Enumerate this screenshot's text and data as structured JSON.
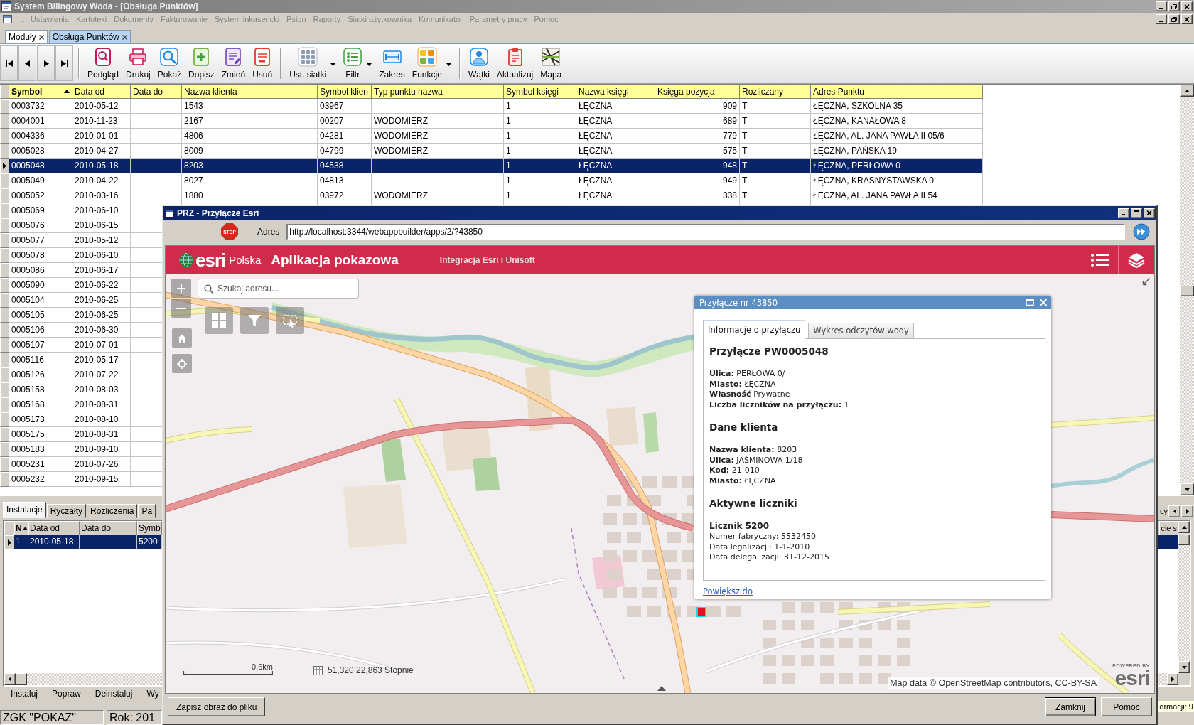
{
  "window": {
    "title": "System Bilingowy Woda - [Obsługa Punktów]"
  },
  "menu": [
    ".",
    "Ustawienia",
    "Kartoteki",
    "Dokumenty",
    "Fakturowanie",
    "System inkasencki",
    "Psion",
    "Raporty",
    "Siatki użytkownika",
    "Komunikator",
    "Parametry pracy",
    "Pomoc"
  ],
  "document_tabs": [
    {
      "label": "Moduły",
      "selected": false
    },
    {
      "label": "Obsługa Punktów",
      "selected": true
    }
  ],
  "toolbar": {
    "groups": [
      [
        {
          "label": "Podgląd",
          "dropdown": false
        },
        {
          "label": "Drukuj",
          "dropdown": false
        },
        {
          "label": "Pokaż",
          "dropdown": false
        },
        {
          "label": "Dopisz",
          "dropdown": false
        },
        {
          "label": "Zmień",
          "dropdown": false
        },
        {
          "label": "Usuń",
          "dropdown": false
        }
      ],
      [
        {
          "label": "Ust. siatki",
          "dropdown": true
        },
        {
          "label": "Filtr",
          "dropdown": true
        },
        {
          "label": "Zakres",
          "dropdown": false
        },
        {
          "label": "Funkcje",
          "dropdown": true
        }
      ],
      [
        {
          "label": "Wątki",
          "dropdown": false
        },
        {
          "label": "Aktualizuj",
          "dropdown": false
        },
        {
          "label": "Mapa",
          "dropdown": false
        }
      ]
    ]
  },
  "table": {
    "columns": [
      {
        "label": "Symbol",
        "sorted": true,
        "kind": "text"
      },
      {
        "label": "Data od",
        "sorted": false,
        "kind": "text"
      },
      {
        "label": "Data do",
        "sorted": false,
        "kind": "text"
      },
      {
        "label": "Nazwa klienta",
        "sorted": false,
        "kind": "text"
      },
      {
        "label": "Symbol klien",
        "sorted": false,
        "kind": "text"
      },
      {
        "label": "Typ punktu nazwa",
        "sorted": false,
        "kind": "text"
      },
      {
        "label": "Symbol księgi",
        "sorted": false,
        "kind": "text"
      },
      {
        "label": "Nazwa księgi",
        "sorted": false,
        "kind": "text"
      },
      {
        "label": "Księga pozycja",
        "sorted": false,
        "kind": "number"
      },
      {
        "label": "Rozliczany",
        "sorted": false,
        "kind": "text"
      },
      {
        "label": "Adres Punktu",
        "sorted": false,
        "kind": "text"
      }
    ],
    "rows": [
      {
        "selected": false,
        "symbol": "0003732",
        "data_od": "2010-05-12",
        "nazwa_klienta": "1543",
        "symbol_klienta": "03967",
        "symbol_ksiegi": "1",
        "nazwa_ksiegi": "ŁĘCZNA",
        "ksiega_pozycja": "909",
        "rozliczany": "T",
        "adres_punktu": "ŁĘCZNA, SZKOLNA 35"
      },
      {
        "selected": false,
        "symbol": "0004001",
        "data_od": "2010-11-23",
        "nazwa_klienta": "2167",
        "symbol_klienta": "00207",
        "typ_punktu_nazwa": "WODOMIERZ",
        "symbol_ksiegi": "1",
        "nazwa_ksiegi": "ŁĘCZNA",
        "ksiega_pozycja": "689",
        "rozliczany": "T",
        "adres_punktu": "ŁĘCZNA, KANAŁOWA 8"
      },
      {
        "selected": false,
        "symbol": "0004336",
        "data_od": "2010-01-01",
        "nazwa_klienta": "4806",
        "symbol_klienta": "04281",
        "typ_punktu_nazwa": "WODOMIERZ",
        "symbol_ksiegi": "1",
        "nazwa_ksiegi": "ŁĘCZNA",
        "ksiega_pozycja": "779",
        "rozliczany": "T",
        "adres_punktu": "ŁĘCZNA, AL. JANA PAWŁA II 05/6"
      },
      {
        "selected": false,
        "symbol": "0005028",
        "data_od": "2010-04-27",
        "nazwa_klienta": "8009",
        "symbol_klienta": "04799",
        "typ_punktu_nazwa": "WODOMIERZ",
        "symbol_ksiegi": "1",
        "nazwa_ksiegi": "ŁĘCZNA",
        "ksiega_pozycja": "575",
        "rozliczany": "T",
        "adres_punktu": "ŁĘCZNA, PAŃSKA 19"
      },
      {
        "selected": true,
        "symbol": "0005048",
        "data_od": "2010-05-18",
        "nazwa_klienta": "8203",
        "symbol_klienta": "04538",
        "symbol_ksiegi": "1",
        "nazwa_ksiegi": "ŁĘCZNA",
        "ksiega_pozycja": "948",
        "rozliczany": "T",
        "adres_punktu": "ŁĘCZNA, PERŁOWA 0"
      },
      {
        "selected": false,
        "symbol": "0005049",
        "data_od": "2010-04-22",
        "nazwa_klienta": "8027",
        "symbol_klienta": "04813",
        "symbol_ksiegi": "1",
        "nazwa_ksiegi": "ŁĘCZNA",
        "ksiega_pozycja": "949",
        "rozliczany": "T",
        "adres_punktu": "ŁĘCZNA, KRASNYSTAWSKA 0"
      },
      {
        "selected": false,
        "symbol": "0005052",
        "data_od": "2010-03-16",
        "nazwa_klienta": "1880",
        "symbol_klienta": "03972",
        "typ_punktu_nazwa": "WODOMIERZ",
        "symbol_ksiegi": "1",
        "nazwa_ksiegi": "ŁĘCZNA",
        "ksiega_pozycja": "338",
        "rozliczany": "T",
        "adres_punktu": "ŁĘCZNA, AL. JANA PAWŁA II 54"
      },
      {
        "selected": false,
        "symbol": "0005069",
        "data_od": "2010-06-10"
      },
      {
        "selected": false,
        "symbol": "0005076",
        "data_od": "2010-06-15"
      },
      {
        "selected": false,
        "symbol": "0005077",
        "data_od": "2010-05-12"
      },
      {
        "selected": false,
        "symbol": "0005078",
        "data_od": "2010-06-10"
      },
      {
        "selected": false,
        "symbol": "0005086",
        "data_od": "2010-06-17"
      },
      {
        "selected": false,
        "symbol": "0005090",
        "data_od": "2010-06-22"
      },
      {
        "selected": false,
        "symbol": "0005104",
        "data_od": "2010-06-25"
      },
      {
        "selected": false,
        "symbol": "0005105",
        "data_od": "2010-06-25"
      },
      {
        "selected": false,
        "symbol": "0005106",
        "data_od": "2010-06-30"
      },
      {
        "selected": false,
        "symbol": "0005107",
        "data_od": "2010-07-01"
      },
      {
        "selected": false,
        "symbol": "0005116",
        "data_od": "2010-05-17"
      },
      {
        "selected": false,
        "symbol": "0005126",
        "data_od": "2010-07-22"
      },
      {
        "selected": false,
        "symbol": "0005158",
        "data_od": "2010-08-03"
      },
      {
        "selected": false,
        "symbol": "0005168",
        "data_od": "2010-08-31"
      },
      {
        "selected": false,
        "symbol": "0005173",
        "data_od": "2010-08-10"
      },
      {
        "selected": false,
        "symbol": "0005175",
        "data_od": "2010-08-31"
      },
      {
        "selected": false,
        "symbol": "0005183",
        "data_od": "2010-09-10"
      },
      {
        "selected": false,
        "symbol": "0005231",
        "data_od": "2010-07-26"
      },
      {
        "selected": false,
        "symbol": "0005232",
        "data_od": "2010-09-15"
      }
    ]
  },
  "detail_panel": {
    "tabs": [
      {
        "label": "Instalacje",
        "selected": true
      },
      {
        "label": "Ryczałty",
        "selected": false
      },
      {
        "label": "Rozliczenia",
        "selected": false
      },
      {
        "label": "Pa",
        "selected": false
      }
    ],
    "tab_fragment": "cy",
    "columns": [
      {
        "label": "N",
        "sorted": true
      },
      {
        "label": "Data od",
        "sorted": false
      },
      {
        "label": "Data do",
        "sorted": false
      },
      {
        "label": "Symb",
        "sorted": false
      }
    ],
    "column_fragment": "cie s",
    "rows": [
      {
        "selected": true,
        "nr": "1",
        "data_od": "2010-05-18",
        "symbol": "5200"
      }
    ],
    "buttons": [
      "Instaluj",
      "Popraw",
      "Deinstaluj",
      "Wy"
    ]
  },
  "status_bar": {
    "panels": [
      "ZGK \"POKAZ\"",
      "Rok: 201"
    ],
    "right_fragment": "ormacji: 9"
  },
  "dialog": {
    "title": "PRZ - Przyłącze Esri",
    "address": {
      "stop": "STOP",
      "label": "Adres",
      "value": "http://localhost:3344/webappbuilder/apps/2/?43850"
    },
    "app": {
      "brand": "esri",
      "brand_suffix": "Polska",
      "title": "Aplikacja pokazowa",
      "subtitle": "Integracja Esri i Unisoft"
    },
    "map": {
      "search": {
        "placeholder": "Szukaj adresu..."
      },
      "scale": "0.6km",
      "coordinates": "51,320 22,863 Stopnie",
      "attribution": "Map data © OpenStreetMap contributors, CC-BY-SA",
      "powered_by": {
        "caption": "POWERED BY",
        "brand": "esri"
      },
      "popup": {
        "title": "Przyłącze nr 43850",
        "tabs": [
          {
            "label": "Informacje o przyłączu",
            "selected": true
          },
          {
            "label": "Wykres odczytów wody",
            "selected": false
          }
        ],
        "content": [
          {
            "kind": "heading",
            "text": "Przyłącze PW0005048"
          },
          {
            "kind": "lines",
            "lines": [
              "**Ulica:** PERŁOWA 0/",
              "**Miasto:** ŁĘCZNA",
              "**Własność** Prywatne",
              "**Liczba liczników na przyłączu:** 1"
            ]
          },
          {
            "kind": "heading",
            "text": "Dane klienta"
          },
          {
            "kind": "lines",
            "lines": [
              "**Nazwa klienta:** 8203",
              "**Ulica:** JAŚMINOWA 1/18",
              "**Kod:** 21-010",
              "**Miasto:** ŁĘCZNA"
            ]
          },
          {
            "kind": "heading",
            "text": "Aktywne liczniki"
          },
          {
            "kind": "subheading",
            "text": "Licznik 5200"
          },
          {
            "kind": "lines",
            "lines": [
              "Numer fabryczny: 5532450",
              "Data legalizacji: 1-1-2010",
              "Data delegalizacji: 31-12-2015"
            ]
          }
        ],
        "link": "Powiększ do"
      }
    },
    "footer": {
      "left": [
        {
          "label": "Zapisz obraz do pliku",
          "default": false
        }
      ],
      "right": [
        {
          "label": "Zamknij",
          "default": true
        },
        {
          "label": "Pomoc",
          "default": false
        }
      ]
    }
  }
}
